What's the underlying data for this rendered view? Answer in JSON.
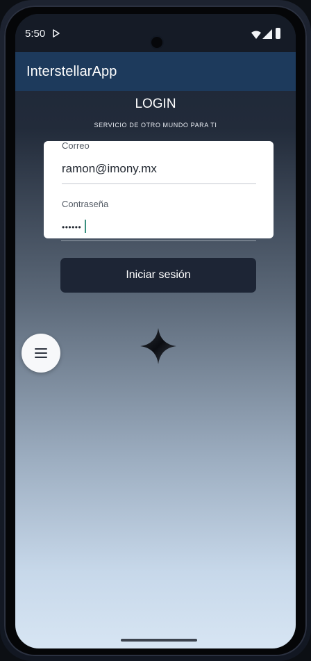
{
  "status_bar": {
    "time": "5:50",
    "icons": [
      "play-icon",
      "wifi-icon",
      "signal-icon",
      "battery-icon"
    ]
  },
  "app_bar": {
    "title": "InterstellarApp"
  },
  "login": {
    "title": "LOGIN",
    "subtitle": "SERVICIO DE OTRO MUNDO PARA TI",
    "email_label": "Correo",
    "email_value": "ramon@imony.mx",
    "password_label": "Contraseña",
    "password_value": "••••••",
    "submit_label": "Iniciar sesión"
  },
  "fab": {
    "icon": "menu-icon"
  },
  "decoration": {
    "icon": "sparkle-icon"
  },
  "colors": {
    "app_bar": "#1d3a5c",
    "button": "#1d2535",
    "caret": "#3a8f7e"
  }
}
